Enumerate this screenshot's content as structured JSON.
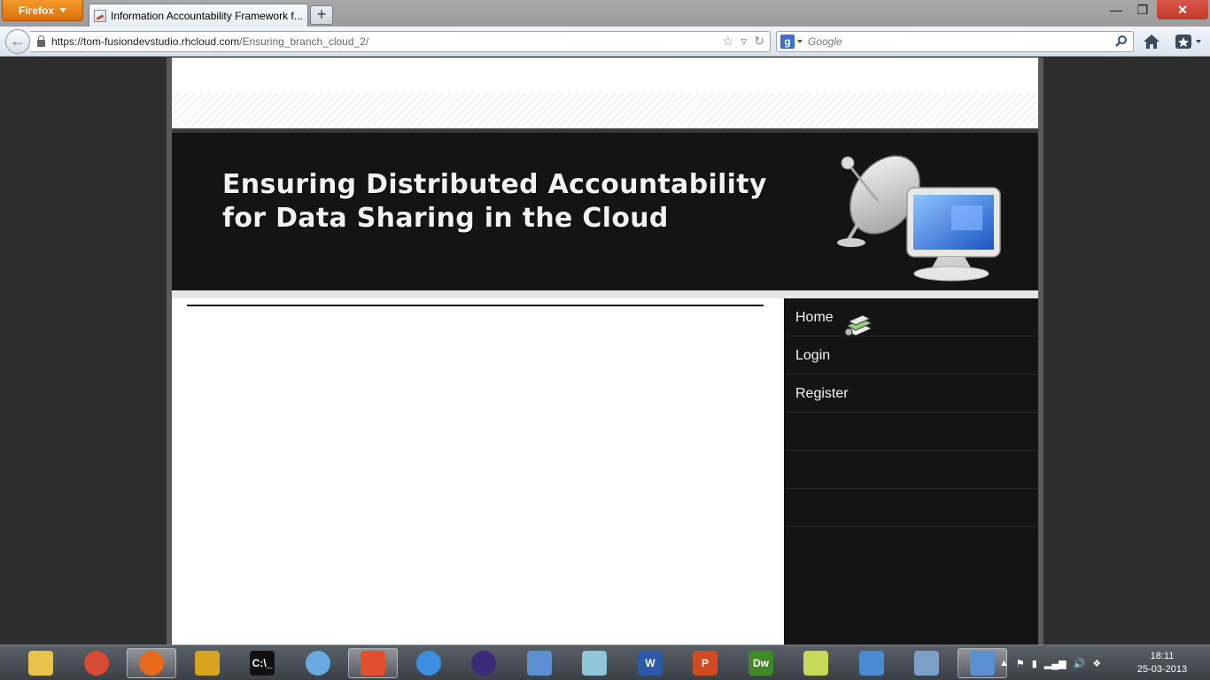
{
  "browser": {
    "app_button": "Firefox",
    "tab_title": "Information Accountability Framework f...",
    "new_tab": "+",
    "url_host": "https://tom-fusiondevstudio.rhcloud.com",
    "url_path": "/Ensuring_branch_cloud_2/",
    "search_engine": "g",
    "search_placeholder": "Google"
  },
  "page": {
    "banner_line1": "Ensuring Distributed Accountability",
    "banner_line2": "for Data Sharing in the Cloud",
    "sidebar_items": [
      {
        "label": "Home"
      },
      {
        "label": "Login"
      },
      {
        "label": "Register"
      },
      {
        "label": ""
      },
      {
        "label": ""
      },
      {
        "label": ""
      }
    ]
  },
  "taskbar": {
    "apps": [
      {
        "icon": "file-explorer-icon",
        "color": "#e8c34a",
        "glyph": ""
      },
      {
        "icon": "chrome-icon",
        "color": "#d84b37",
        "glyph": ""
      },
      {
        "icon": "firefox-icon",
        "color": "#e66a1c",
        "glyph": ""
      },
      {
        "icon": "network-app-icon",
        "color": "#d9a322",
        "glyph": ""
      },
      {
        "icon": "command-prompt-icon",
        "color": "#111111",
        "glyph": "C:\\_"
      },
      {
        "icon": "finder-icon",
        "color": "#6aa8e0",
        "glyph": ""
      },
      {
        "icon": "git-icon",
        "color": "#e0502f",
        "glyph": ""
      },
      {
        "icon": "itunes-icon",
        "color": "#3c8ede",
        "glyph": ""
      },
      {
        "icon": "eclipse-icon",
        "color": "#3a2a7a",
        "glyph": ""
      },
      {
        "icon": "virtualbox-icon",
        "color": "#5a8fd0",
        "glyph": ""
      },
      {
        "icon": "notes-icon",
        "color": "#8fc6d8",
        "glyph": ""
      },
      {
        "icon": "word-icon",
        "color": "#2a5aa8",
        "glyph": "W"
      },
      {
        "icon": "powerpoint-icon",
        "color": "#d04a24",
        "glyph": "P"
      },
      {
        "icon": "dreamweaver-icon",
        "color": "#3f8a26",
        "glyph": "Dw"
      },
      {
        "icon": "sticky-notes-icon",
        "color": "#c8d85a",
        "glyph": ""
      },
      {
        "icon": "control-panel-icon",
        "color": "#4a8ad0",
        "glyph": ""
      },
      {
        "icon": "performance-monitor-icon",
        "color": "#7aa0c8",
        "glyph": ""
      },
      {
        "icon": "virtualbox-vm-icon",
        "color": "#5a8fd0",
        "glyph": ""
      }
    ],
    "clock_time": "18:11",
    "clock_date": "25-03-2013"
  }
}
